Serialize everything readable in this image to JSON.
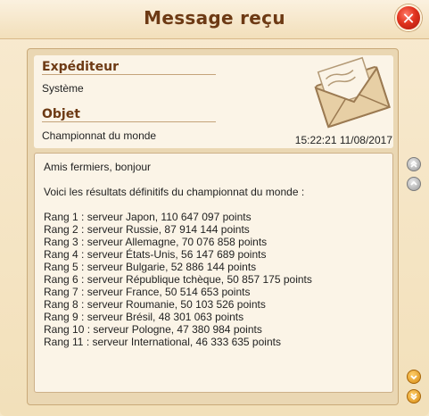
{
  "window": {
    "title": "Message reçu",
    "close_label": "✕"
  },
  "sender": {
    "label": "Expéditeur",
    "value": "Système"
  },
  "subject": {
    "label": "Objet",
    "value": "Championnat du monde"
  },
  "timestamp": "15:22:21 11/08/2017",
  "message": {
    "greeting": "Amis fermiers, bonjour",
    "intro": "Voici les résultats définitifs du championnat du monde :",
    "ranks": [
      "Rang 1 : serveur Japon, 110 647 097 points",
      "Rang 2 : serveur Russie, 87 914 144 points",
      "Rang 3 : serveur Allemagne, 70 076 858 points",
      "Rang 4 : serveur États-Unis, 56 147 689 points",
      "Rang 5 : serveur Bulgarie, 52 886 144 points",
      "Rang 6 : serveur République tchèque, 50 857 175 points",
      "Rang 7 : serveur France, 50 514 653 points",
      "Rang 8 : serveur Roumanie, 50 103 526 points",
      "Rang 9 : serveur Brésil, 48 301 063 points",
      "Rang 10 : serveur Pologne, 47 380 984 points",
      "Rang 11 : serveur International, 46 333 635 points"
    ]
  },
  "scroll_controls": [
    "scroll-to-top",
    "scroll-up",
    "scroll-down",
    "scroll-to-bottom"
  ],
  "icons": {
    "close": "close-icon",
    "envelope": "envelope-icon"
  },
  "colors": {
    "title": "#6d3a14",
    "close": "#e0321d",
    "scroll_active": "#d68a12",
    "scroll_inactive": "#9a9a9a"
  }
}
